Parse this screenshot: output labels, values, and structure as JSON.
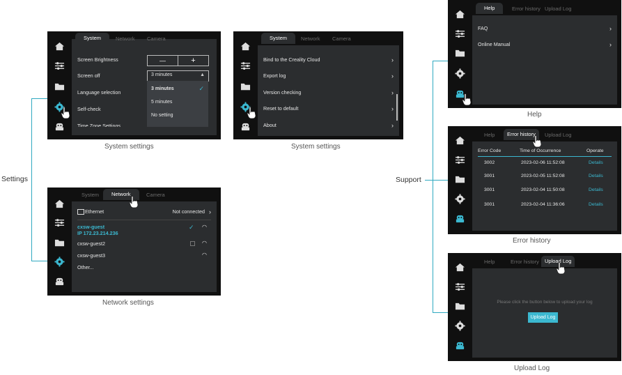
{
  "labels": {
    "settings": "Settings",
    "support": "Support"
  },
  "captions": {
    "system1": "System settings",
    "system2": "System settings",
    "network": "Network settings",
    "help": "Help",
    "error_history": "Error history",
    "upload_log": "Upload Log"
  },
  "tabs": {
    "system": "System",
    "network": "Network",
    "camera": "Camera",
    "help": "Help",
    "error_history": "Error history",
    "upload_log": "Upload Log"
  },
  "system1": {
    "rows": [
      "Screen Brightness",
      "Screen off",
      "Language selection",
      "Self-check",
      "Time Zone Settings"
    ],
    "minus": "—",
    "plus": "+",
    "select_value": "3 minutes",
    "options": [
      "3 minutes",
      "5 minutes",
      "No setting"
    ],
    "check": "✓"
  },
  "system2": {
    "rows": [
      "Bind to the Creality Cloud",
      "Export log",
      "Version checking",
      "Reset to default",
      "About"
    ]
  },
  "network": {
    "ethernet": "Ethernet",
    "eth_status": "Not connected",
    "wifi": [
      {
        "name": "cxsw-guest",
        "ip": "IP  172.23.214.236"
      },
      {
        "name": "cxsw-guest2"
      },
      {
        "name": "cxsw-guest3"
      }
    ],
    "other": "Other..."
  },
  "help": {
    "rows": [
      "FAQ",
      "Online Manual"
    ]
  },
  "errors": {
    "headers": [
      "Error Code",
      "Time of Occurrence",
      "Operate"
    ],
    "rows": [
      {
        "code": "3002",
        "time": "2023-02-06  11:52:08",
        "op": "Details"
      },
      {
        "code": "3001",
        "time": "2023-02-05  11:52:08",
        "op": "Details"
      },
      {
        "code": "3001",
        "time": "2023-02-04  11:50:08",
        "op": "Details"
      },
      {
        "code": "3001",
        "time": "2023-02-04  11:36:06",
        "op": "Details"
      }
    ]
  },
  "upload": {
    "message": "Please click the button below to upload your log",
    "button": "Upload Log"
  },
  "colors": {
    "accent": "#3bb8d0",
    "bracket": "#2fa9c0",
    "panel": "#2b2d2f",
    "frame": "#101010"
  },
  "icons": [
    "home-icon",
    "sliders-icon",
    "folder-icon",
    "gear-icon",
    "robot-icon",
    "hand-pointer-icon",
    "chevron-right-icon",
    "wifi-icon",
    "lock-icon",
    "monitor-icon",
    "check-icon"
  ]
}
